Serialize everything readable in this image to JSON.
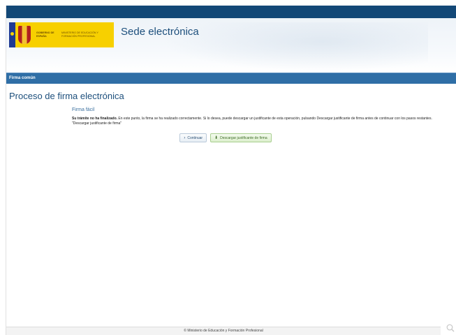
{
  "header": {
    "logo_gov": "GOBIERNO DE ESPAÑA",
    "logo_ministry": "MINISTERIO DE EDUCACIÓN Y FORMACIÓN PROFESIONAL",
    "site_title": "Sede electrónica"
  },
  "nav": {
    "label": "Firma común"
  },
  "main": {
    "page_title": "Proceso de firma electrónica",
    "section_title": "Firma fácil",
    "message_bold": "Su trámite no ha finalizado.",
    "message_rest": " En este punto, la firma se ha realizado correctamente. Si lo desea, puede descargar un justificante de esta operación, pulsando Descargar justificante de firma antes de continuar con los pasos restantes. \"Descargar justificante de firma\"",
    "buttons": {
      "continue_label": "Continuar",
      "continue_icon": "arrow-right-icon",
      "download_label": "Descargar justificante de firma",
      "download_icon": "download-icon"
    }
  },
  "footer": {
    "text": "© Ministerio de Educación y Formación Profesional"
  },
  "colors": {
    "topbar": "#134877",
    "nav": "#2f6ea6",
    "title": "#1d4f7c",
    "logo_yellow": "#f7d000"
  }
}
